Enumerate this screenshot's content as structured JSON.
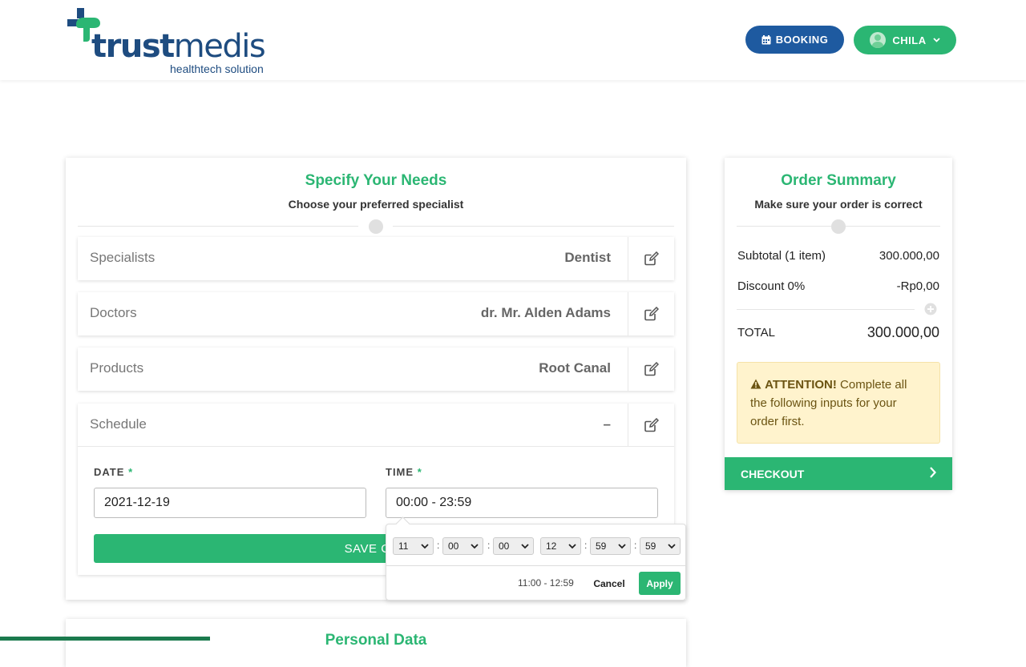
{
  "header": {
    "logo": {
      "word_bold": "trust",
      "word_light": "medis",
      "tagline": "healthtech solution"
    },
    "booking_label": "BOOKING",
    "user_label": "CHILA"
  },
  "needs": {
    "title": "Specify Your Needs",
    "subtitle": "Choose your preferred specialist",
    "rows": [
      {
        "label": "Specialists",
        "value": "Dentist"
      },
      {
        "label": "Doctors",
        "value": "dr. Mr. Alden Adams"
      },
      {
        "label": "Products",
        "value": "Root Canal"
      }
    ],
    "schedule": {
      "label": "Schedule",
      "value": "–",
      "date_label": "DATE",
      "time_label": "TIME",
      "required_mark": "*",
      "date_value": "2021-12-19",
      "time_value": "00:00 - 23:59",
      "save_label": "SAVE CHA"
    }
  },
  "time_picker": {
    "start_hour": "11",
    "start_minute": "00",
    "start_second": "00",
    "end_hour": "12",
    "end_minute": "59",
    "end_second": "59",
    "separator": ":",
    "range": "11:00 - 12:59",
    "cancel_label": "Cancel",
    "apply_label": "Apply"
  },
  "summary": {
    "title": "Order Summary",
    "subtitle": "Make sure your order is correct",
    "subtotal_label": "Subtotal (1 item)",
    "subtotal_value": "300.000,00",
    "discount_label": "Discount 0%",
    "discount_value": "-Rp0,00",
    "total_label": "TOTAL",
    "total_value": "300.000,00",
    "attention_strong": "ATTENTION!",
    "attention_text": " Complete all the following inputs for your order first.",
    "checkout_label": "CHECKOUT"
  },
  "next_section": {
    "title": "Personal Data"
  },
  "colors": {
    "green": "#2bb673",
    "blue": "#1e5aa0",
    "navy": "#1e4c80",
    "warning_bg": "#fff3cd"
  }
}
